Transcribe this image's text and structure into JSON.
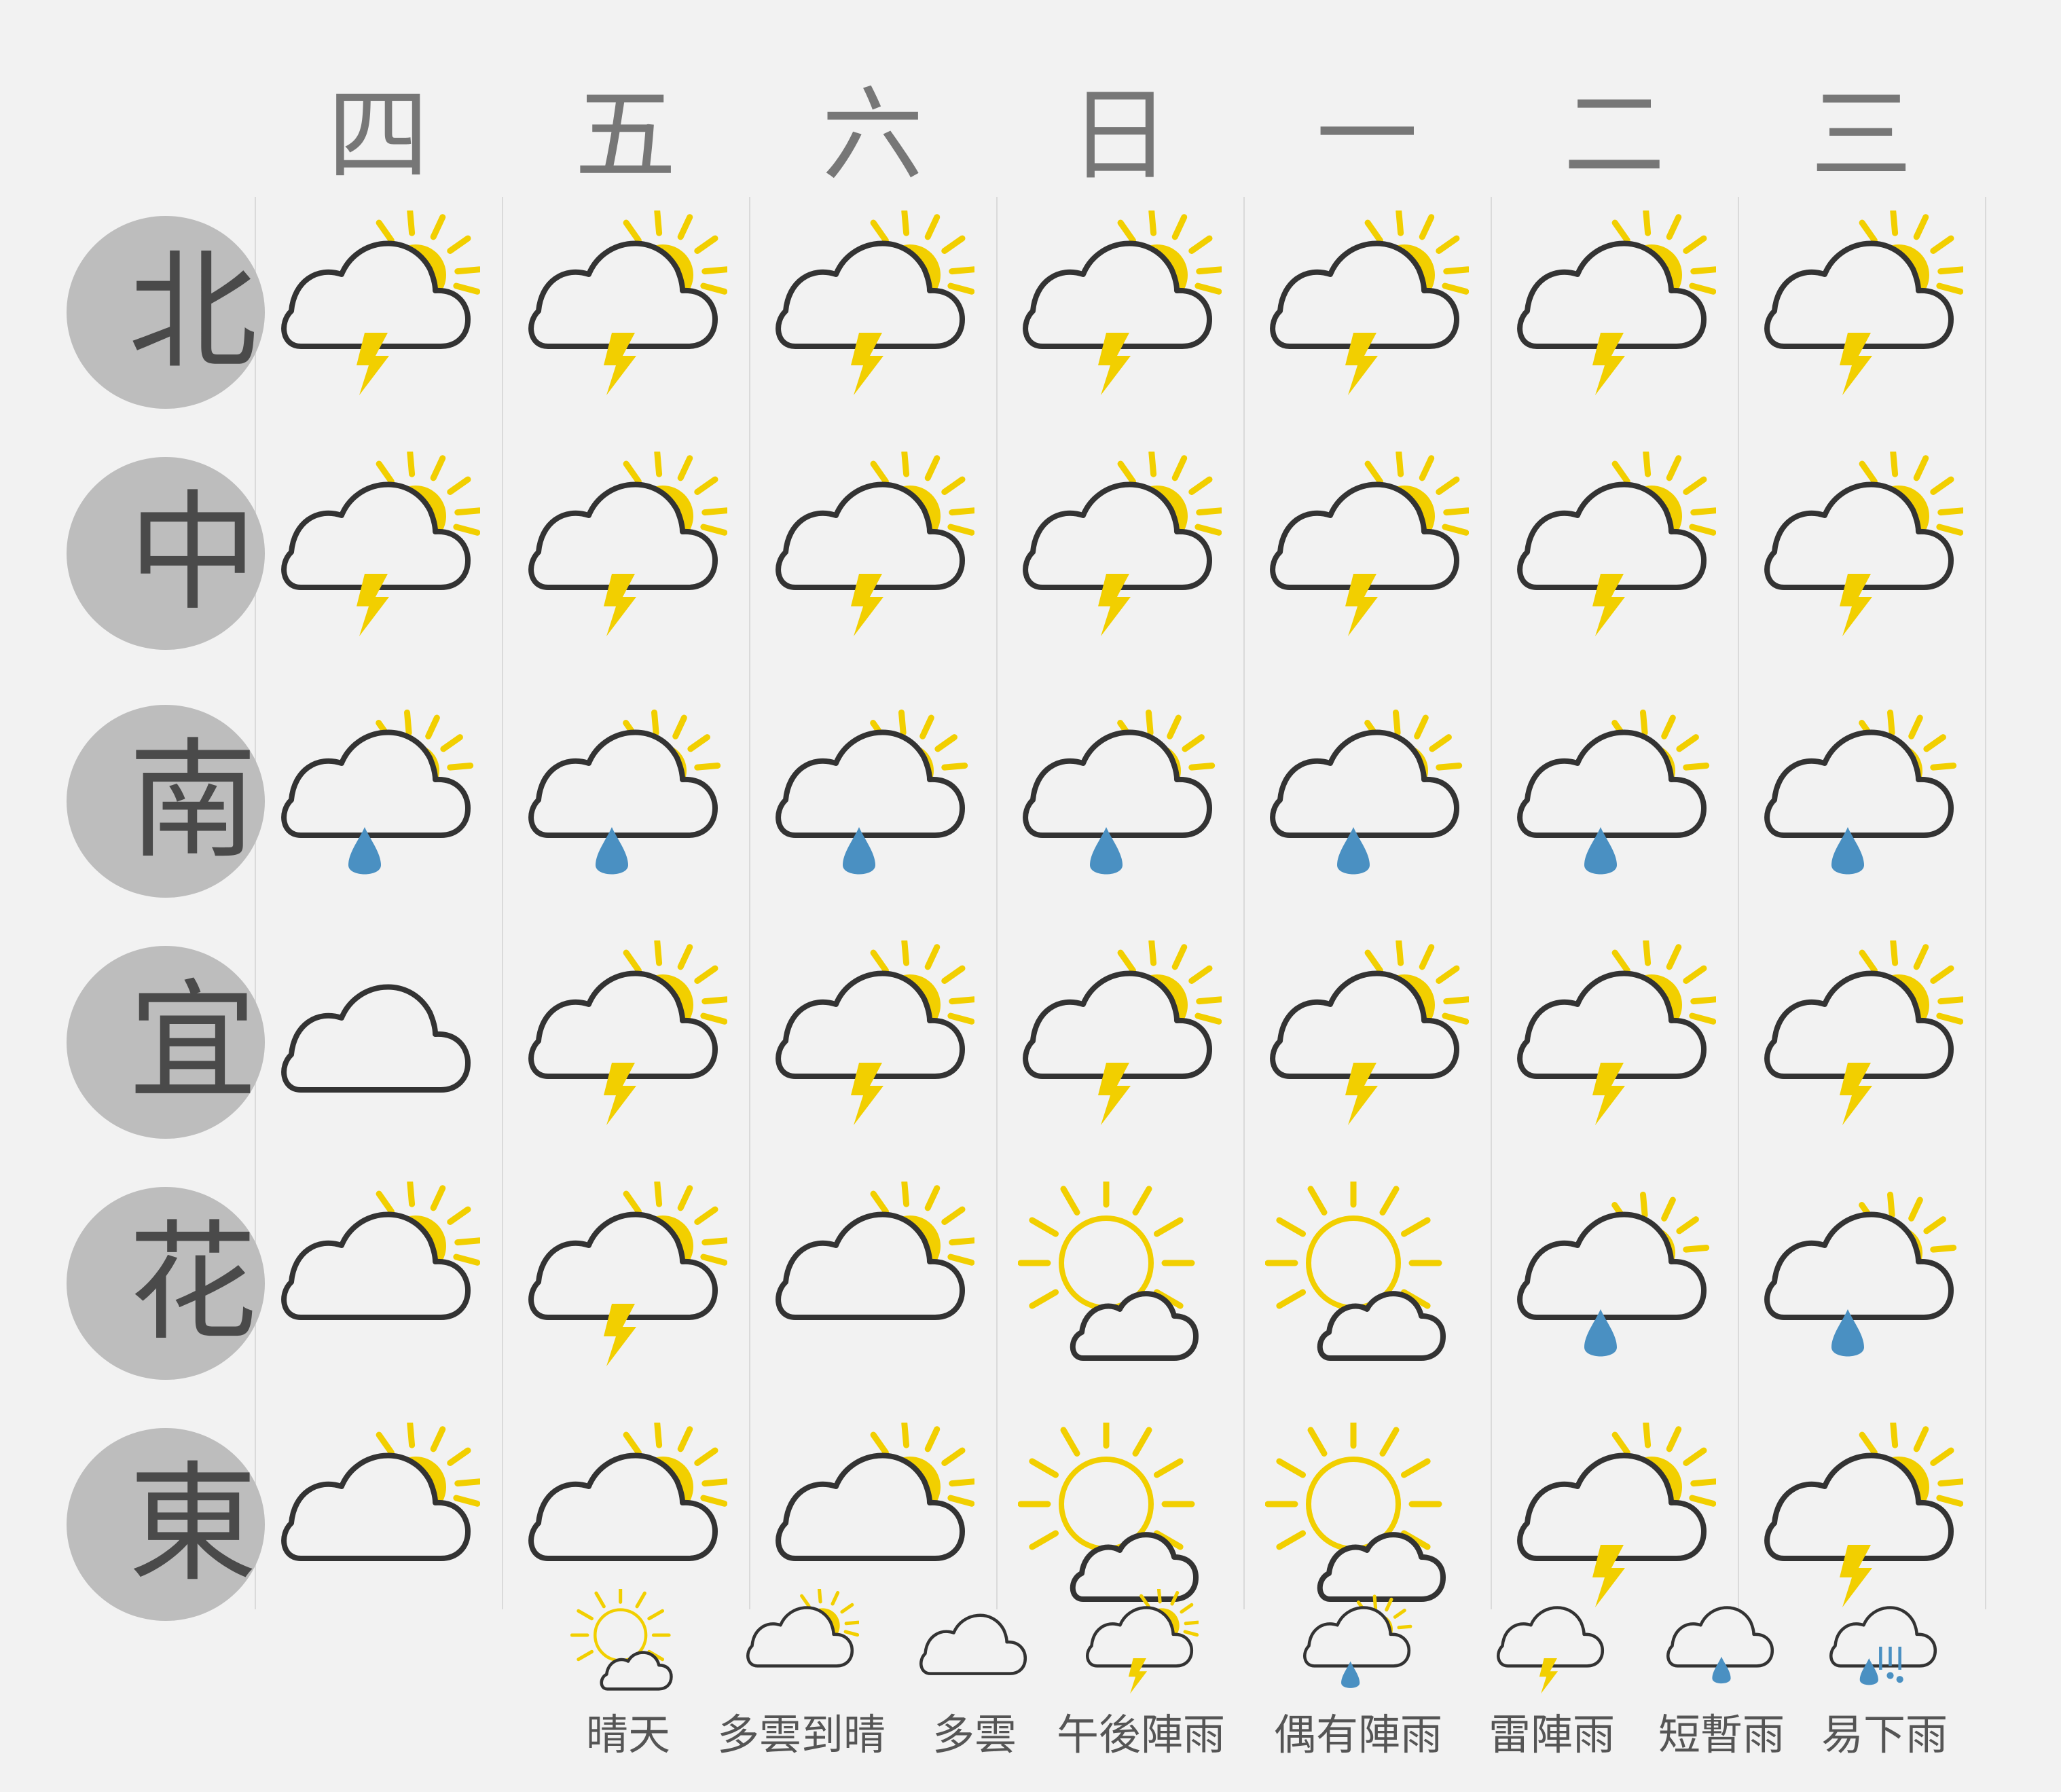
{
  "days": [
    "四",
    "五",
    "六",
    "日",
    "一",
    "二",
    "三"
  ],
  "regions": [
    "北",
    "中",
    "南",
    "宜",
    "花",
    "東"
  ],
  "grid": [
    [
      "thunder",
      "thunder",
      "thunder",
      "thunder",
      "thunder",
      "thunder",
      "thunder"
    ],
    [
      "thunder",
      "thunder",
      "thunder",
      "thunder",
      "thunder",
      "thunder",
      "thunder"
    ],
    [
      "showers",
      "showers",
      "showers",
      "showers",
      "showers",
      "showers",
      "showers"
    ],
    [
      "cloudy",
      "thunder",
      "thunder",
      "thunder",
      "thunder",
      "thunder",
      "thunder"
    ],
    [
      "partly",
      "thunder",
      "partly",
      "sunny",
      "sunny",
      "showers",
      "showers"
    ],
    [
      "partly",
      "partly",
      "partly",
      "sunny",
      "sunny",
      "thunder",
      "thunder"
    ]
  ],
  "legend": [
    {
      "type": "sunny",
      "label": "晴天"
    },
    {
      "type": "partly",
      "label": "多雲到晴"
    },
    {
      "type": "cloudy",
      "label": "多雲"
    },
    {
      "type": "thunder",
      "label": "午後陣雨"
    },
    {
      "type": "showers",
      "label": "偶有陣雨"
    },
    {
      "type": "storm",
      "label": "雷陣雨"
    },
    {
      "type": "rain",
      "label": "短暫雨"
    },
    {
      "type": "heavy",
      "label": "易下雨"
    }
  ],
  "icon_names": {
    "sunny": "sunny-icon",
    "partly": "partly-cloudy-icon",
    "cloudy": "cloudy-icon",
    "thunder": "afternoon-thunderstorm-icon",
    "showers": "occasional-showers-icon",
    "storm": "thunder-shower-icon",
    "rain": "brief-rain-icon",
    "heavy": "heavy-rain-icon"
  },
  "colors": {
    "sun": "#f2cf00",
    "cloud_stroke": "#333333",
    "raindrop": "#4a90c2",
    "bolt": "#f2cf00",
    "region_circle": "#bdbdbd",
    "day_text": "#777777"
  }
}
